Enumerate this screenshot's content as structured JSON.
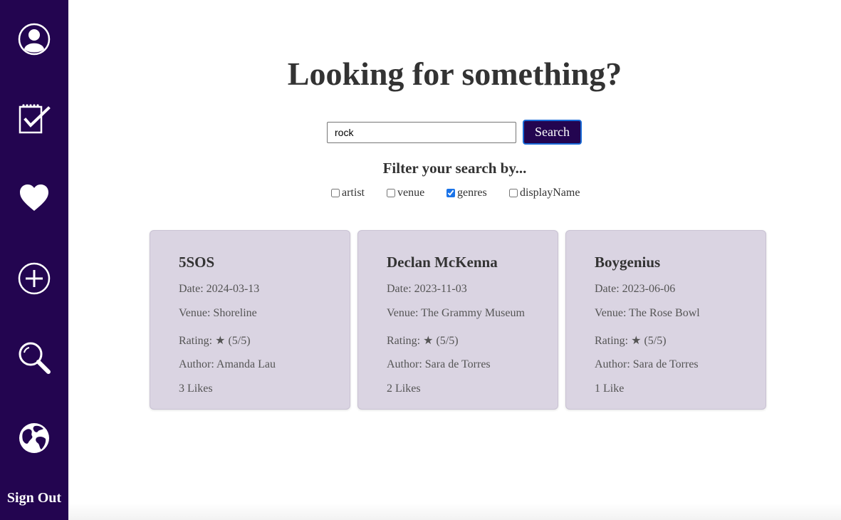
{
  "sidebar": {
    "items": [
      {
        "icon": "profile-icon"
      },
      {
        "icon": "checklist-icon"
      },
      {
        "icon": "heart-icon"
      },
      {
        "icon": "add-icon"
      },
      {
        "icon": "search-icon"
      },
      {
        "icon": "globe-icon"
      }
    ],
    "sign_out_label": "Sign Out",
    "background": "#230550"
  },
  "page": {
    "heading": "Looking for something?"
  },
  "search": {
    "value": "rock",
    "button_label": "Search",
    "button_color": "#230550"
  },
  "filter": {
    "title": "Filter your search by...",
    "options": [
      {
        "label": "artist",
        "checked": false
      },
      {
        "label": "venue",
        "checked": false
      },
      {
        "label": "genres",
        "checked": true
      },
      {
        "label": "displayName",
        "checked": false
      }
    ]
  },
  "results": [
    {
      "title": "5SOS",
      "date": "Date: 2024-03-13",
      "venue": "Venue: Shoreline",
      "rating": "Rating: ★ (5/5)",
      "author": "Author: Amanda Lau",
      "likes": "3 Likes"
    },
    {
      "title": "Declan McKenna",
      "date": "Date: 2023-11-03",
      "venue": "Venue: The Grammy Museum",
      "rating": "Rating: ★ (5/5)",
      "author": "Author: Sara de Torres",
      "likes": "2 Likes"
    },
    {
      "title": "Boygenius",
      "date": "Date: 2023-06-06",
      "venue": "Venue: The Rose Bowl",
      "rating": "Rating: ★ (5/5)",
      "author": "Author: Sara de Torres",
      "likes": "1 Like"
    }
  ],
  "colors": {
    "card_background": "#dad4e2",
    "text": "#333333"
  }
}
